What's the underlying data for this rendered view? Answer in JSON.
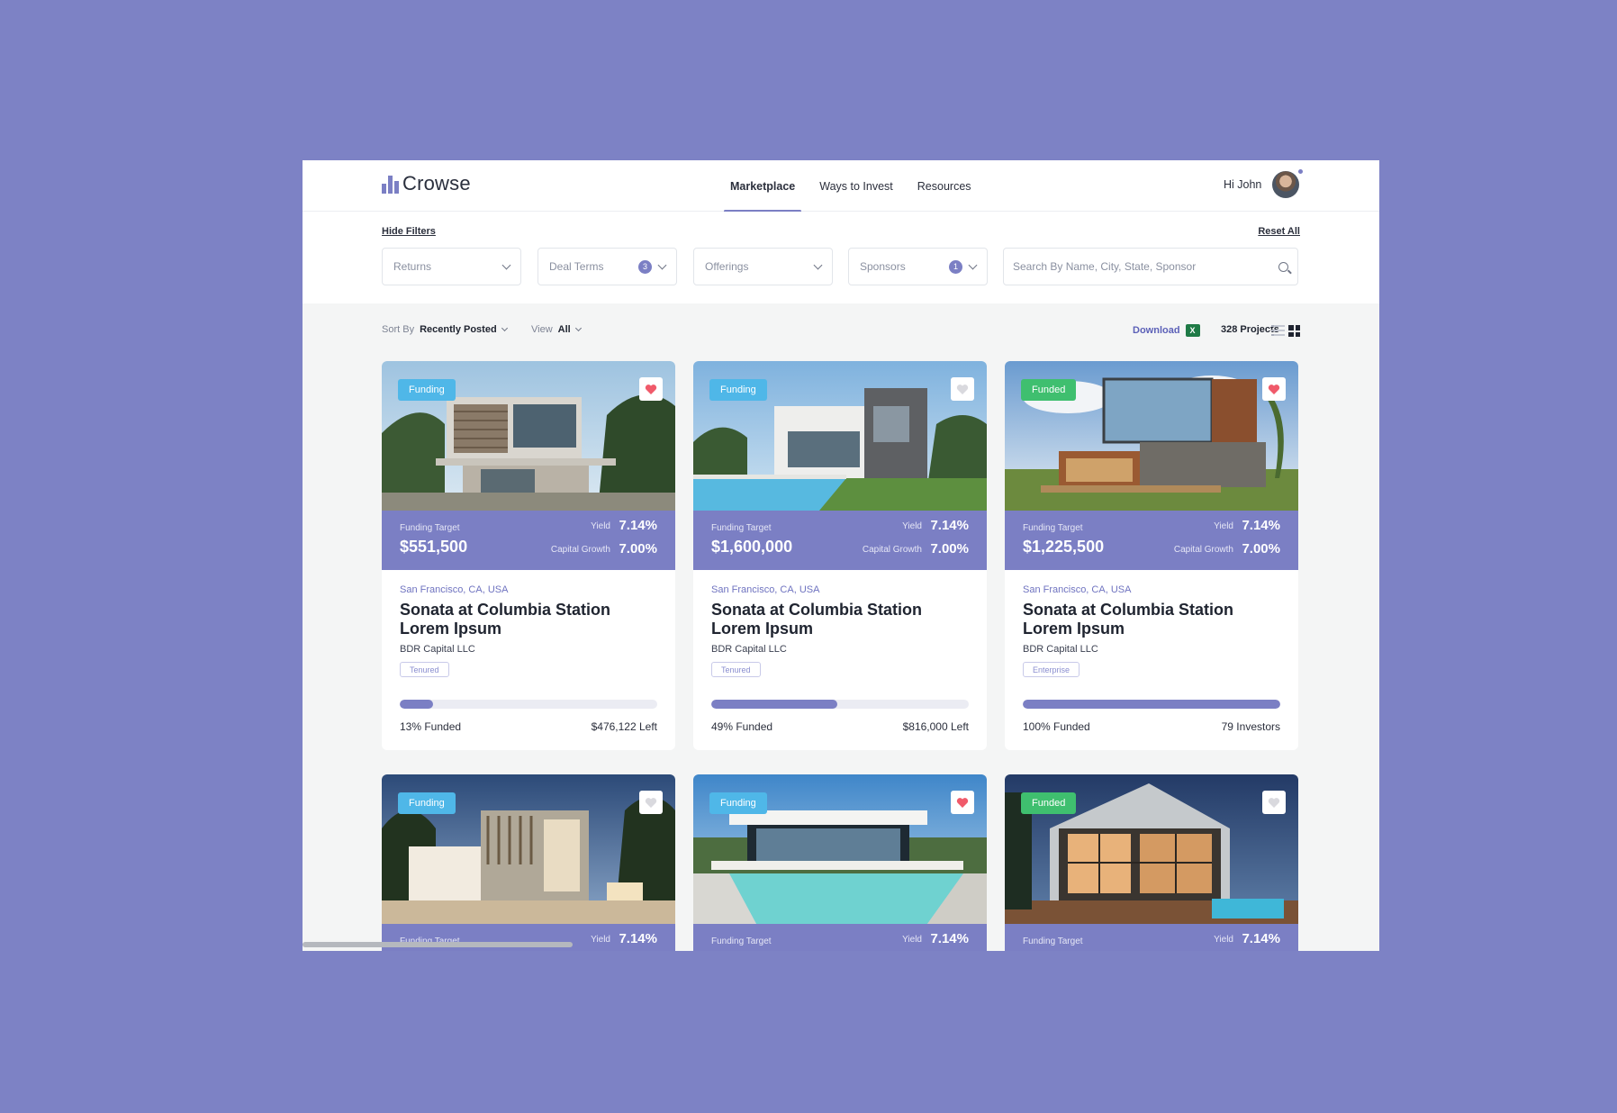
{
  "brand": {
    "name": "Crowse",
    "accent": "#7b7fc4",
    "background": "#7d82c5"
  },
  "nav": {
    "items": [
      {
        "label": "Marketplace",
        "active": true
      },
      {
        "label": "Ways to Invest",
        "active": false
      },
      {
        "label": "Resources",
        "active": false
      }
    ]
  },
  "user": {
    "greeting": "Hi John"
  },
  "filters": {
    "hide_label": "Hide Filters",
    "reset_label": "Reset All",
    "dropdowns": [
      {
        "label": "Returns",
        "badge": ""
      },
      {
        "label": "Deal Terms",
        "badge": "3"
      },
      {
        "label": "Offerings",
        "badge": ""
      },
      {
        "label": "Sponsors",
        "badge": "1"
      }
    ],
    "search_placeholder": "Search By Name, City, State, Sponsor"
  },
  "toolbar": {
    "sort_label": "Sort By",
    "sort_value": "Recently Posted",
    "view_label": "View",
    "view_value": "All",
    "download_label": "Download",
    "excel_glyph": "X",
    "project_count": "328 Projects"
  },
  "cards": [
    {
      "status": "Funding",
      "status_type": "funding",
      "favorited": true,
      "target_label": "Funding Target",
      "target": "$551,500",
      "yield_label": "Yield",
      "yield": "7.14%",
      "growth_label": "Capital Growth",
      "growth": "7.00%",
      "location": "San Francisco, CA, USA",
      "title": "Sonata at Columbia Station Lorem Ipsum",
      "sponsor": "BDR Capital LLC",
      "tag": "Tenured",
      "progress": 13,
      "funded_text": "13% Funded",
      "right_text": "$476,122 Left"
    },
    {
      "status": "Funding",
      "status_type": "funding",
      "favorited": false,
      "target_label": "Funding Target",
      "target": "$1,600,000",
      "yield_label": "Yield",
      "yield": "7.14%",
      "growth_label": "Capital Growth",
      "growth": "7.00%",
      "location": "San Francisco, CA, USA",
      "title": "Sonata at Columbia Station Lorem Ipsum",
      "sponsor": "BDR Capital LLC",
      "tag": "Tenured",
      "progress": 49,
      "funded_text": "49% Funded",
      "right_text": "$816,000 Left"
    },
    {
      "status": "Funded",
      "status_type": "funded",
      "favorited": true,
      "target_label": "Funding Target",
      "target": "$1,225,500",
      "yield_label": "Yield",
      "yield": "7.14%",
      "growth_label": "Capital Growth",
      "growth": "7.00%",
      "location": "San Francisco, CA, USA",
      "title": "Sonata at Columbia Station Lorem Ipsum",
      "sponsor": "BDR Capital LLC",
      "tag": "Enterprise",
      "progress": 100,
      "funded_text": "100% Funded",
      "right_text": "79 Investors"
    },
    {
      "status": "Funding",
      "status_type": "funding",
      "favorited": false,
      "target_label": "Funding Target",
      "yield_label": "Yield",
      "yield": "7.14%"
    },
    {
      "status": "Funding",
      "status_type": "funding",
      "favorited": true,
      "target_label": "Funding Target",
      "yield_label": "Yield",
      "yield": "7.14%"
    },
    {
      "status": "Funded",
      "status_type": "funded",
      "favorited": false,
      "target_label": "Funding Target",
      "yield_label": "Yield",
      "yield": "7.14%"
    }
  ]
}
